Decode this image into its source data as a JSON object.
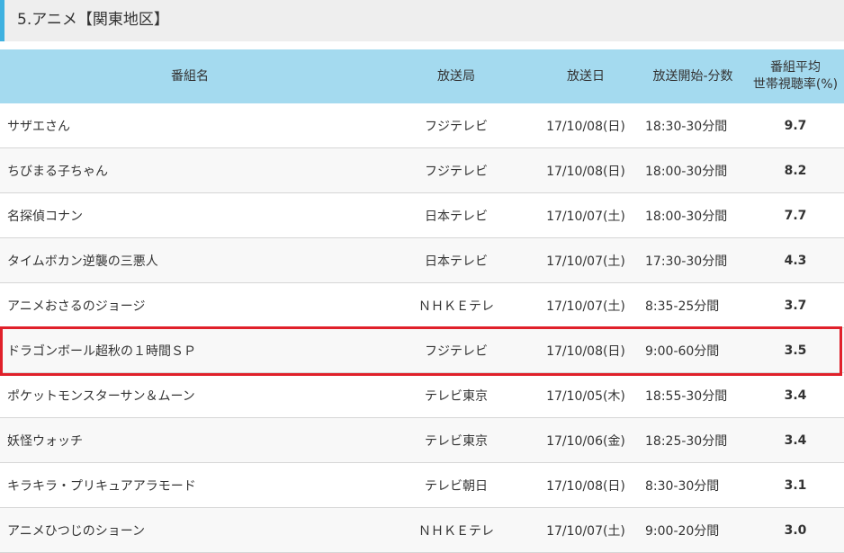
{
  "section": {
    "title": "5.アニメ【関東地区】",
    "accent_color": "#3fb1e0"
  },
  "table": {
    "header_color": "#a4daef",
    "headers": {
      "name": "番組名",
      "station": "放送局",
      "date": "放送日",
      "time": "放送開始-分数",
      "rating_line1": "番組平均",
      "rating_line2": "世帯視聴率(%)"
    },
    "rows": [
      {
        "name": "サザエさん",
        "station": "フジテレビ",
        "date": "17/10/08(日)",
        "time": "18:30-30分間",
        "rating": "9.7"
      },
      {
        "name": "ちびまる子ちゃん",
        "station": "フジテレビ",
        "date": "17/10/08(日)",
        "time": "18:00-30分間",
        "rating": "8.2"
      },
      {
        "name": "名探偵コナン",
        "station": "日本テレビ",
        "date": "17/10/07(土)",
        "time": "18:00-30分間",
        "rating": "7.7"
      },
      {
        "name": "タイムボカン逆襲の三悪人",
        "station": "日本テレビ",
        "date": "17/10/07(土)",
        "time": "17:30-30分間",
        "rating": "4.3"
      },
      {
        "name": "アニメおさるのジョージ",
        "station": "ＮＨＫＥテレ",
        "date": "17/10/07(土)",
        "time": " 8:35-25分間",
        "rating": "3.7"
      },
      {
        "name": "ドラゴンボール超秋の１時間ＳＰ",
        "station": "フジテレビ",
        "date": "17/10/08(日)",
        "time": " 9:00-60分間",
        "rating": "3.5"
      },
      {
        "name": "ポケットモンスターサン＆ムーン",
        "station": "テレビ東京",
        "date": "17/10/05(木)",
        "time": "18:55-30分間",
        "rating": "3.4"
      },
      {
        "name": "妖怪ウォッチ",
        "station": "テレビ東京",
        "date": "17/10/06(金)",
        "time": "18:25-30分間",
        "rating": "3.4"
      },
      {
        "name": "キラキラ・プリキュアアラモード",
        "station": "テレビ朝日",
        "date": "17/10/08(日)",
        "time": " 8:30-30分間",
        "rating": "3.1"
      },
      {
        "name": "アニメひつじのショーン",
        "station": "ＮＨＫＥテレ",
        "date": "17/10/07(土)",
        "time": " 9:00-20分間",
        "rating": "3.0"
      }
    ],
    "highlight_color": "#e0202a"
  }
}
